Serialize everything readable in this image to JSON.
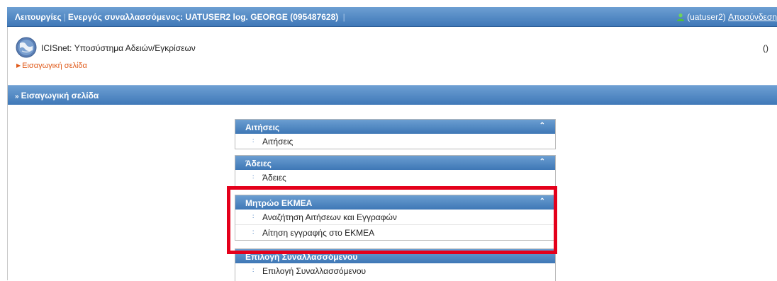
{
  "topbar": {
    "menu_label": "Λειτουργίες",
    "active_user": "Ενεργός συναλλασσόμενος: UATUSER2 log. GEORGE (095487628)",
    "username": "(uatuser2)",
    "logout": "Αποσύνδεση"
  },
  "header": {
    "app_title": "ICISnet: Υποσύστημα Αδειών/Εγκρίσεων",
    "count": "()",
    "home_link": "Εισαγωγική σελίδα"
  },
  "section": {
    "title": "Εισαγωγική σελίδα"
  },
  "panels": [
    {
      "title": "Αιτήσεις",
      "items": [
        "Αιτήσεις"
      ]
    },
    {
      "title": "Άδειες",
      "items": [
        "Άδειες"
      ]
    },
    {
      "title": "Μητρώο ΕΚΜΕΑ",
      "items": [
        "Αναζήτηση Αιτήσεων και Εγγραφών",
        "Αίτηση εγγραφής στο ΕΚΜΕΑ"
      ]
    },
    {
      "title": "Επιλογή Συναλλασσόμενου",
      "items": [
        "Επιλογή Συναλλασσόμενου"
      ]
    }
  ],
  "colors": {
    "header_blue": "#4f86c4",
    "link_orange": "#e05a1a",
    "highlight_red": "#e4001b"
  }
}
